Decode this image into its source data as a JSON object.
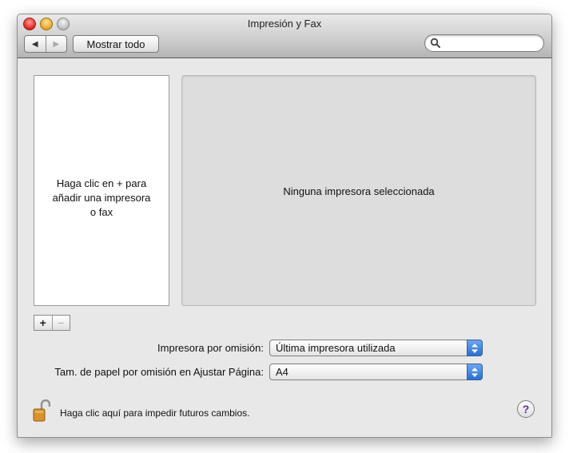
{
  "window": {
    "title": "Impresión y Fax"
  },
  "toolbar": {
    "back_icon": "triangle-left-icon",
    "forward_icon": "triangle-right-icon",
    "show_all_label": "Mostrar todo",
    "search_value": "",
    "search_icon": "magnifier-icon"
  },
  "printer_list": {
    "empty_line1": "Haga clic en + para",
    "empty_line2": "añadir una impresora",
    "empty_line3": "o fax",
    "add_label": "+",
    "remove_label": "−"
  },
  "detail": {
    "no_printer_text": "Ninguna impresora seleccionada"
  },
  "defaults": {
    "printer_label": "Impresora por omisión:",
    "printer_value": "Última impresora utilizada",
    "paper_label": "Tam. de papel por omisión en Ajustar Página:",
    "paper_value": "A4"
  },
  "footer": {
    "lock_icon": "open-padlock-icon",
    "lock_text": "Haga clic aquí para impedir futuros cambios.",
    "help_label": "?"
  },
  "colors": {
    "popup_arrow": "#2a6fd6",
    "help_mark": "#5a2ea8",
    "lock_body": "#d9922a"
  }
}
